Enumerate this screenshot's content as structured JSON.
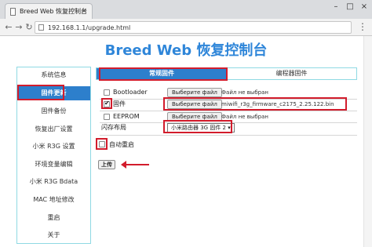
{
  "browser": {
    "tab_title": "Breed Web 恢复控制台",
    "tab_close": "×",
    "url": "192.168.1.1/upgrade.html",
    "icons": {
      "back": "back-arrow-icon",
      "forward": "forward-arrow-icon",
      "reload": "reload-icon",
      "menu": "menu-icon"
    },
    "window_controls": {
      "minimize": "–",
      "maximize": "□",
      "close": "×"
    }
  },
  "page": {
    "title": "Breed Web 恢复控制台"
  },
  "sidebar": {
    "items": [
      {
        "label": "系统信息",
        "active": false
      },
      {
        "label": "固件更新",
        "active": true
      },
      {
        "label": "固件备份",
        "active": false
      },
      {
        "label": "恢复出厂设置",
        "active": false
      },
      {
        "label": "小米 R3G 设置",
        "active": false
      },
      {
        "label": "环境变量编辑",
        "active": false
      },
      {
        "label": "小米 R3G Bdata",
        "active": false
      },
      {
        "label": "MAC 地址修改",
        "active": false
      },
      {
        "label": "重启",
        "active": false
      },
      {
        "label": "关于",
        "active": false
      }
    ]
  },
  "tabs": [
    {
      "label": "常规固件",
      "active": true
    },
    {
      "label": "编程器固件",
      "active": false
    }
  ],
  "form": {
    "bootloader": {
      "label": "Bootloader",
      "checked": false,
      "button": "Выберите файл",
      "file": "Файл не выбран"
    },
    "firmware": {
      "label": "固件",
      "checked": true,
      "button": "Выберите файл",
      "file": "miwifi_r3g_firmware_c2175_2.25.122.bin"
    },
    "eeprom": {
      "label": "EEPROM",
      "checked": false,
      "button": "Выберите файл",
      "file": "Файл не выбран"
    },
    "flash_layout": {
      "label": "闪存布局",
      "selected": "小米路由器 3G 固件 2 ▾"
    },
    "auto_reboot": {
      "label": "自动重启",
      "checked": false
    },
    "upload_button": "上传"
  },
  "annotation_color": "#d21c2c",
  "accent_color": "#2d7fcc",
  "title_color": "#2f86d9"
}
